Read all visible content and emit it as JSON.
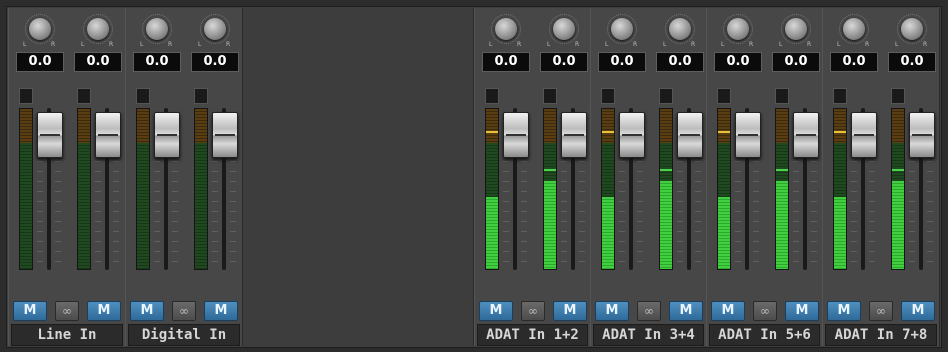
{
  "groups": [
    {
      "name": "Line In",
      "mute_left": "M",
      "mute_right": "M",
      "link_icon": "∞",
      "channels": [
        {
          "value": "0.0",
          "level": 0
        },
        {
          "value": "0.0",
          "level": 0
        }
      ]
    },
    {
      "name": "Digital In",
      "mute_left": "M",
      "mute_right": "M",
      "link_icon": "∞",
      "channels": [
        {
          "value": "0.0",
          "level": 0
        },
        {
          "value": "0.0",
          "level": 0
        }
      ]
    },
    {
      "name": "ADAT In 1+2",
      "mute_left": "M",
      "mute_right": "M",
      "link_icon": "∞",
      "channels": [
        {
          "value": "0.0",
          "level": 0.45
        },
        {
          "value": "0.0",
          "level": 0.55
        }
      ]
    },
    {
      "name": "ADAT In 3+4",
      "mute_left": "M",
      "mute_right": "M",
      "link_icon": "∞",
      "channels": [
        {
          "value": "0.0",
          "level": 0.45
        },
        {
          "value": "0.0",
          "level": 0.55
        }
      ]
    },
    {
      "name": "ADAT In 5+6",
      "mute_left": "M",
      "mute_right": "M",
      "link_icon": "∞",
      "channels": [
        {
          "value": "0.0",
          "level": 0.45
        },
        {
          "value": "0.0",
          "level": 0.55
        }
      ]
    },
    {
      "name": "ADAT In 7+8",
      "mute_left": "M",
      "mute_right": "M",
      "link_icon": "∞",
      "channels": [
        {
          "value": "0.0",
          "level": 0.45
        },
        {
          "value": "0.0",
          "level": 0.55
        }
      ]
    }
  ],
  "knob_labels": {
    "left": "L",
    "right": "R"
  },
  "colors": {
    "mute": "#3a7db0",
    "meter_green": "#3fcf3f",
    "peak": "#e8c23a"
  }
}
